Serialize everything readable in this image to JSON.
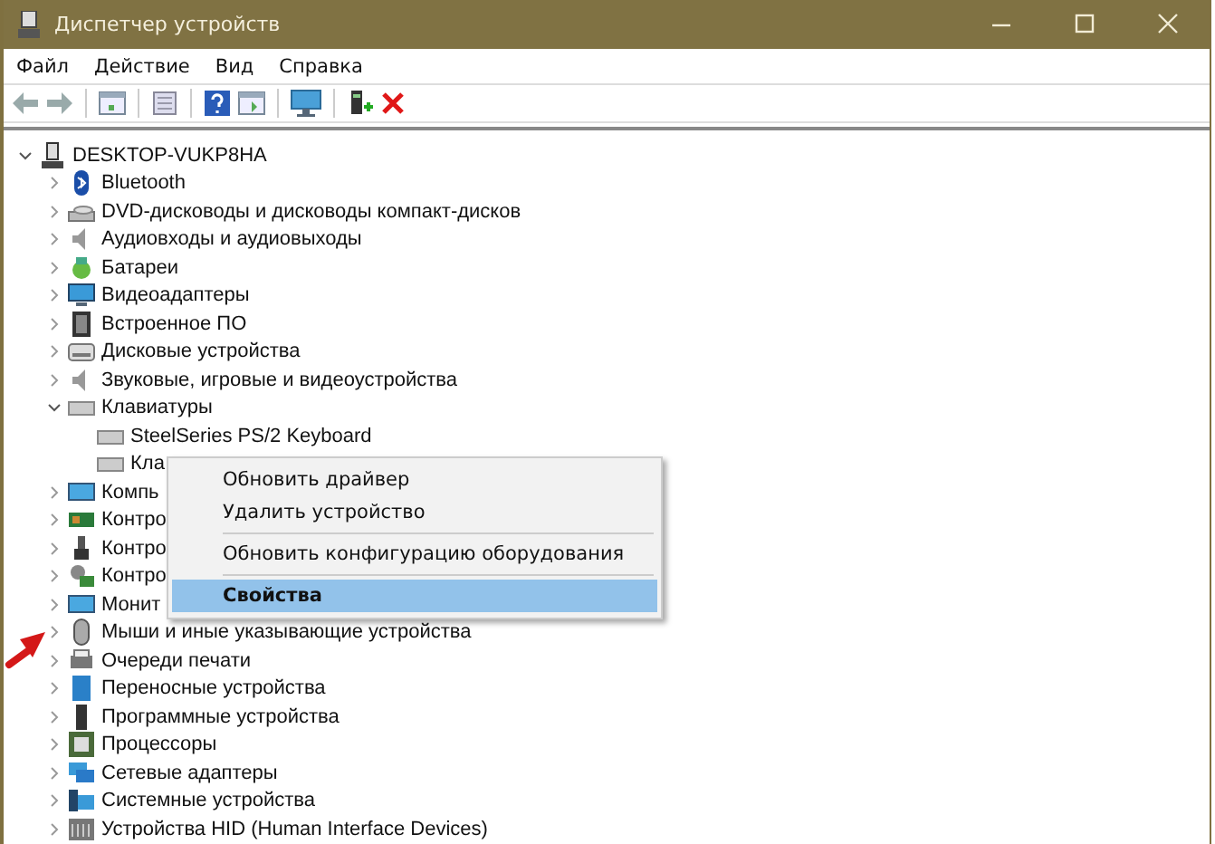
{
  "window": {
    "title": "Диспетчер устройств"
  },
  "menu_bar": [
    "Файл",
    "Действие",
    "Вид",
    "Справка"
  ],
  "tree": {
    "label": "DESKTOP-VUKP8HA",
    "expanded": true,
    "children": [
      {
        "label": "Bluetooth",
        "expanded": false
      },
      {
        "label": "DVD-дисководы и дисководы компакт-дисков",
        "expanded": false
      },
      {
        "label": "Аудиовходы и аудиовыходы",
        "expanded": false
      },
      {
        "label": "Батареи",
        "expanded": false
      },
      {
        "label": "Видеоадаптеры",
        "expanded": false
      },
      {
        "label": "Встроенное ПО",
        "expanded": false
      },
      {
        "label": "Дисковые устройства",
        "expanded": false
      },
      {
        "label": "Звуковые, игровые и видеоустройства",
        "expanded": false
      },
      {
        "label": "Клавиатуры",
        "expanded": true,
        "children": [
          {
            "label": "SteelSeries PS/2 Keyboard"
          },
          {
            "label": "Кла"
          }
        ]
      },
      {
        "label": "Компь",
        "expanded": false
      },
      {
        "label": "Контро",
        "expanded": false
      },
      {
        "label": "Контро",
        "expanded": false
      },
      {
        "label": "Контро",
        "expanded": false
      },
      {
        "label": "Монит",
        "expanded": false
      },
      {
        "label": "Мыши и иные указывающие устройства",
        "expanded": false
      },
      {
        "label": "Очереди печати",
        "expanded": false
      },
      {
        "label": "Переносные устройства",
        "expanded": false
      },
      {
        "label": "Программные устройства",
        "expanded": false
      },
      {
        "label": "Процессоры",
        "expanded": false
      },
      {
        "label": "Сетевые адаптеры",
        "expanded": false
      },
      {
        "label": "Системные устройства",
        "expanded": false
      },
      {
        "label": "Устройства HID (Human Interface Devices)",
        "expanded": false
      }
    ]
  },
  "context_menu": [
    {
      "label": "Обновить драйвер",
      "selected": false,
      "separator_after": false
    },
    {
      "label": "Удалить устройство",
      "selected": false,
      "separator_after": true
    },
    {
      "label": "Обновить конфигурацию оборудования",
      "selected": false,
      "separator_after": true
    },
    {
      "label": "Свойства",
      "selected": true,
      "separator_after": false
    }
  ]
}
